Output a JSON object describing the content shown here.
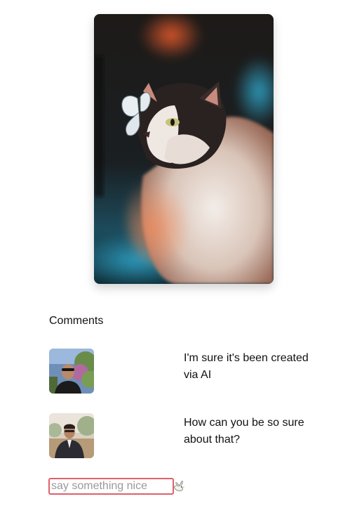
{
  "post": {
    "image_description_icon": "cat-with-butterfly-photo"
  },
  "comments_section": {
    "heading": "Comments",
    "items": [
      {
        "avatar_icon": "user-avatar-1",
        "text": "I'm sure it's been created via AI"
      },
      {
        "avatar_icon": "user-avatar-2",
        "text": "How can you be so sure about that?"
      }
    ]
  },
  "comment_form": {
    "placeholder": "say something nice",
    "value": "",
    "send_icon": "dove-icon",
    "input_border_color": "#e0606a"
  }
}
